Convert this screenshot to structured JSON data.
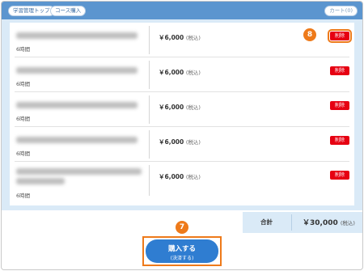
{
  "header": {
    "tag1": "学習管理トップ",
    "tag2": "コース購入",
    "cart": "カート(0)"
  },
  "rows": [
    {
      "duration": "6時間",
      "price": "￥6,000",
      "tax": "(税込)",
      "delete": "削除"
    },
    {
      "duration": "6時間",
      "price": "￥6,000",
      "tax": "(税込)",
      "delete": "削除"
    },
    {
      "duration": "6時間",
      "price": "￥6,000",
      "tax": "(税込)",
      "delete": "削除"
    },
    {
      "duration": "6時間",
      "price": "￥6,000",
      "tax": "(税込)",
      "delete": "削除"
    },
    {
      "duration": "6時間",
      "price": "￥6,000",
      "tax": "(税込)",
      "delete": "削除"
    }
  ],
  "total": {
    "label": "合計",
    "value": "￥30,000",
    "tax": "(税込)"
  },
  "buy": {
    "label": "購入する",
    "sub": "(決済する)"
  },
  "steps": {
    "delete_step": "8",
    "buy_step": "7"
  },
  "colors": {
    "topbar": "#5b95cf",
    "delete": "#e60012",
    "buy": "#2f7dd1",
    "highlight": "#ee7a1a"
  }
}
